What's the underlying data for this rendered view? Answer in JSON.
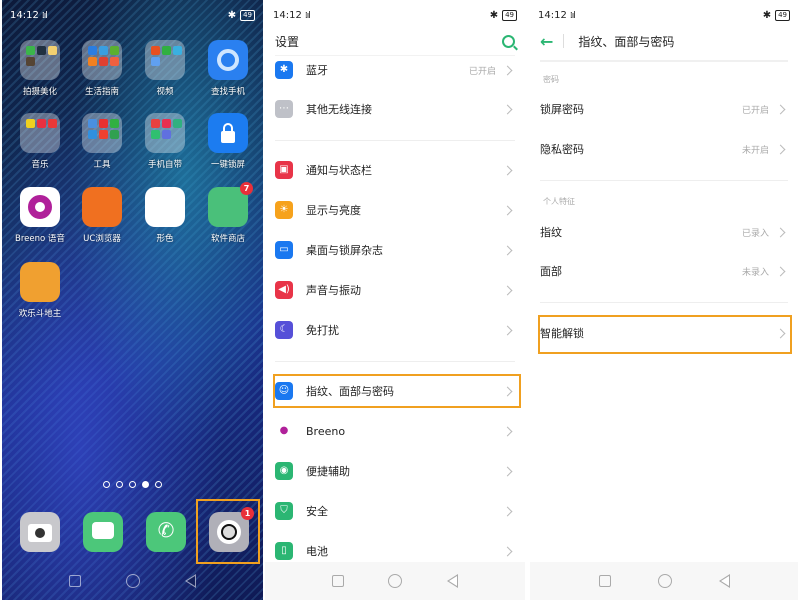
{
  "status": {
    "time": "14:12",
    "signal": "⁞ıl",
    "battery": "49",
    "bluetooth": "✱"
  },
  "home": {
    "apps": [
      {
        "label": "拍摄美化",
        "type": "folder",
        "colors": [
          "#3bb54a",
          "#203040",
          "#f3d070",
          "#554433"
        ]
      },
      {
        "label": "生活指南",
        "type": "folder",
        "colors": [
          "#2a7de1",
          "#3a9ee0",
          "#5ab030",
          "#f08020",
          "#e04030",
          "#f06040"
        ]
      },
      {
        "label": "视频",
        "type": "folder",
        "colors": [
          "#e85020",
          "#30b040",
          "#3ab0e0",
          "#60a0f0"
        ]
      },
      {
        "label": "查找手机",
        "type": "app",
        "color": "#2a80f0"
      },
      {
        "label": "音乐",
        "type": "folder",
        "colors": [
          "#f0d020",
          "#e83040",
          "#e83838"
        ]
      },
      {
        "label": "工具",
        "type": "folder",
        "colors": [
          "#4a90e0",
          "#e83030",
          "#30b040",
          "#3090e0",
          "#f04030",
          "#30a050"
        ]
      },
      {
        "label": "手机自带",
        "type": "folder",
        "colors": [
          "#e84040",
          "#e83050",
          "#30b080",
          "#30c070",
          "#6070e0"
        ]
      },
      {
        "label": "一键锁屏",
        "type": "app",
        "color": "#1c7cf0"
      },
      {
        "label": "Breeno 语音",
        "type": "app",
        "color": "#ffffff"
      },
      {
        "label": "UC浏览器",
        "type": "app",
        "color": "#f07020"
      },
      {
        "label": "形色",
        "type": "app",
        "color": "#ffffff"
      },
      {
        "label": "软件商店",
        "type": "app",
        "color": "#4ac07a",
        "badge": "7"
      },
      {
        "label": "欢乐斗地主",
        "type": "app",
        "color": "#f0a030"
      }
    ],
    "page_dots": 5,
    "active_dot": 4,
    "dock": [
      {
        "name": "camera",
        "color": "#c8c8cc"
      },
      {
        "name": "messages",
        "color": "#4cc77a"
      },
      {
        "name": "phone",
        "color": "#4cc77a"
      },
      {
        "name": "settings",
        "color": "#b0b0b8",
        "badge": "1"
      }
    ]
  },
  "settings": {
    "title": "设置",
    "items": [
      {
        "label": "蓝牙",
        "value": "已开启",
        "icon": "bluetooth-icon",
        "glyph": "✱",
        "color": "#1a78f0"
      },
      {
        "label": "其他无线连接",
        "value": "",
        "icon": "more-icon",
        "glyph": "⋯",
        "color": "#bfc1c8"
      },
      {
        "label": "通知与状态栏",
        "value": "",
        "icon": "notification-icon",
        "glyph": "▣",
        "color": "#e83448"
      },
      {
        "label": "显示与亮度",
        "value": "",
        "icon": "brightness-icon",
        "glyph": "☀",
        "color": "#f6a21c"
      },
      {
        "label": "桌面与锁屏杂志",
        "value": "",
        "icon": "wallpaper-icon",
        "glyph": "▭",
        "color": "#1a78f0"
      },
      {
        "label": "声音与振动",
        "value": "",
        "icon": "sound-icon",
        "glyph": "◀)",
        "color": "#e83448"
      },
      {
        "label": "免打扰",
        "value": "",
        "icon": "moon-icon",
        "glyph": "☾",
        "color": "#5650d8"
      },
      {
        "label": "指纹、面部与密码",
        "value": "",
        "icon": "fingerprint-face-icon",
        "glyph": "☺",
        "color": "#1a78f0"
      },
      {
        "label": "Breeno",
        "value": "",
        "icon": "breeno-icon",
        "glyph": "●",
        "color": "#ffffff"
      },
      {
        "label": "便捷辅助",
        "value": "",
        "icon": "assist-icon",
        "glyph": "◉",
        "color": "#2bb673"
      },
      {
        "label": "安全",
        "value": "",
        "icon": "shield-icon",
        "glyph": "⛉",
        "color": "#2bb673"
      },
      {
        "label": "电池",
        "value": "",
        "icon": "battery-icon",
        "glyph": "▯",
        "color": "#2bb673"
      }
    ]
  },
  "security": {
    "title": "指纹、面部与密码",
    "back": "←",
    "section_password": "密码",
    "password_items": [
      {
        "label": "锁屏密码",
        "value": "已开启"
      },
      {
        "label": "隐私密码",
        "value": "未开启"
      }
    ],
    "section_biometric": "个人特征",
    "biometric_items": [
      {
        "label": "指纹",
        "value": "已录入"
      },
      {
        "label": "面部",
        "value": "未录入"
      }
    ],
    "smart_unlock": "智能解锁"
  },
  "colors": {
    "accent": "#2bb673",
    "highlight": "#f0a020",
    "badge": "#e8303a"
  }
}
